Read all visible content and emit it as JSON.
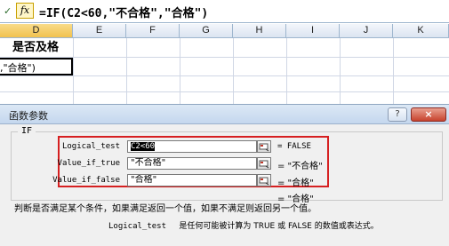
{
  "formula_bar": {
    "fx_label": "fx",
    "formula": "=IF(C2<60,\"不合格\",\"合格\")"
  },
  "sheet": {
    "columns": [
      "D",
      "E",
      "F",
      "G",
      "H",
      "I",
      "J",
      "K"
    ],
    "active_column": "D",
    "d2_text": "是否及格",
    "d3_text": ",\"合格\")"
  },
  "dialog": {
    "title": "函数参数",
    "help_glyph": "?",
    "close_glyph": "×",
    "group_label": "IF",
    "args": [
      {
        "label": "Logical_test",
        "value": "C2<60",
        "result": "= FALSE"
      },
      {
        "label": "Value_if_true",
        "value": "\"不合格\"",
        "result": "= \"不合格\""
      },
      {
        "label": "Value_if_false",
        "value": "\"合格\"",
        "result": "= \"合格\""
      }
    ],
    "overall_result": "= \"合格\"",
    "description": "判断是否满足某个条件，如果满足返回一个值，如果不满足则返回另一个值。",
    "arg_help_name": "Logical_test",
    "arg_help_text": "是任何可能被计算为 TRUE 或 FALSE 的数值或表达式。",
    "highlight_color": "#d62021"
  }
}
